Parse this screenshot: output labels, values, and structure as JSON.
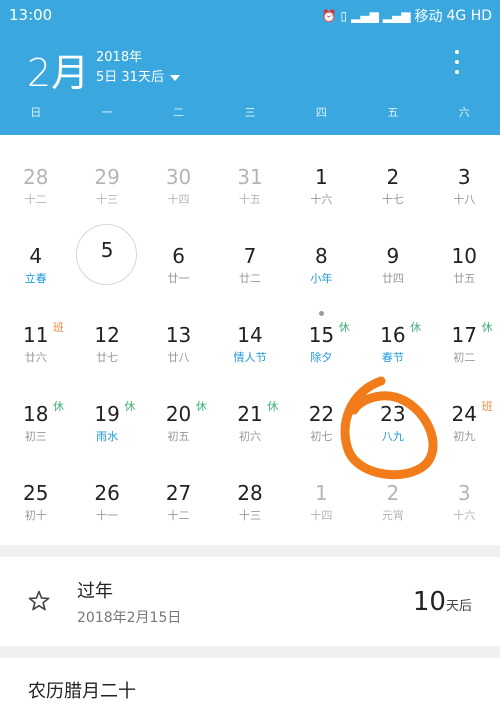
{
  "status": {
    "time": "13:00",
    "carrier": "移动",
    "network": "4G HD",
    "icons": [
      "alarm-icon",
      "vibrate-icon",
      "signal-icon",
      "signal-icon"
    ]
  },
  "header": {
    "month": "2月",
    "year": "2018年",
    "subtitle": "5日  31天后",
    "weekdays": [
      "日",
      "一",
      "二",
      "三",
      "四",
      "五",
      "六"
    ]
  },
  "calendar": {
    "selected_day": "5",
    "rows": [
      [
        {
          "num": "28",
          "lunar": "十二",
          "other": true
        },
        {
          "num": "29",
          "lunar": "十三",
          "other": true
        },
        {
          "num": "30",
          "lunar": "十四",
          "other": true
        },
        {
          "num": "31",
          "lunar": "十五",
          "other": true
        },
        {
          "num": "1",
          "lunar": "十六"
        },
        {
          "num": "2",
          "lunar": "十七"
        },
        {
          "num": "3",
          "lunar": "十八"
        }
      ],
      [
        {
          "num": "4",
          "lunar": "立春",
          "blue": true
        },
        {
          "num": "5",
          "lunar": "",
          "selected": true
        },
        {
          "num": "6",
          "lunar": "廿一"
        },
        {
          "num": "7",
          "lunar": "廿二"
        },
        {
          "num": "8",
          "lunar": "小年",
          "blue": true
        },
        {
          "num": "9",
          "lunar": "廿四"
        },
        {
          "num": "10",
          "lunar": "廿五"
        }
      ],
      [
        {
          "num": "11",
          "lunar": "廿六",
          "badge": "班",
          "badgeType": "work"
        },
        {
          "num": "12",
          "lunar": "廿七"
        },
        {
          "num": "13",
          "lunar": "廿八"
        },
        {
          "num": "14",
          "lunar": "情人节",
          "blue": true
        },
        {
          "num": "15",
          "lunar": "除夕",
          "blue": true,
          "badge": "休",
          "dot": true
        },
        {
          "num": "16",
          "lunar": "春节",
          "blue": true,
          "badge": "休"
        },
        {
          "num": "17",
          "lunar": "初二",
          "badge": "休"
        }
      ],
      [
        {
          "num": "18",
          "lunar": "初三",
          "badge": "休"
        },
        {
          "num": "19",
          "lunar": "雨水",
          "blue": true,
          "badge": "休"
        },
        {
          "num": "20",
          "lunar": "初五",
          "badge": "休"
        },
        {
          "num": "21",
          "lunar": "初六",
          "badge": "休"
        },
        {
          "num": "22",
          "lunar": "初七"
        },
        {
          "num": "23",
          "lunar": "八九",
          "blue": true
        },
        {
          "num": "24",
          "lunar": "初九",
          "badge": "班",
          "badgeType": "work"
        }
      ],
      [
        {
          "num": "25",
          "lunar": "初十"
        },
        {
          "num": "26",
          "lunar": "十一"
        },
        {
          "num": "27",
          "lunar": "十二"
        },
        {
          "num": "28",
          "lunar": "十三"
        },
        {
          "num": "1",
          "lunar": "十四",
          "other": true
        },
        {
          "num": "2",
          "lunar": "元宵",
          "other": true
        },
        {
          "num": "3",
          "lunar": "十六",
          "other": true
        }
      ]
    ]
  },
  "event": {
    "title": "过年",
    "date": "2018年2月15日",
    "count": "10",
    "unit": "天后",
    "icon": "star-icon"
  },
  "lunar_date": "农历腊月二十",
  "colors": {
    "header": "#3aa8df",
    "holiday_badge": "#3fb075",
    "work_badge": "#f08a43",
    "festival_text": "#1e9bd8",
    "annotation": "#f27c1a"
  }
}
